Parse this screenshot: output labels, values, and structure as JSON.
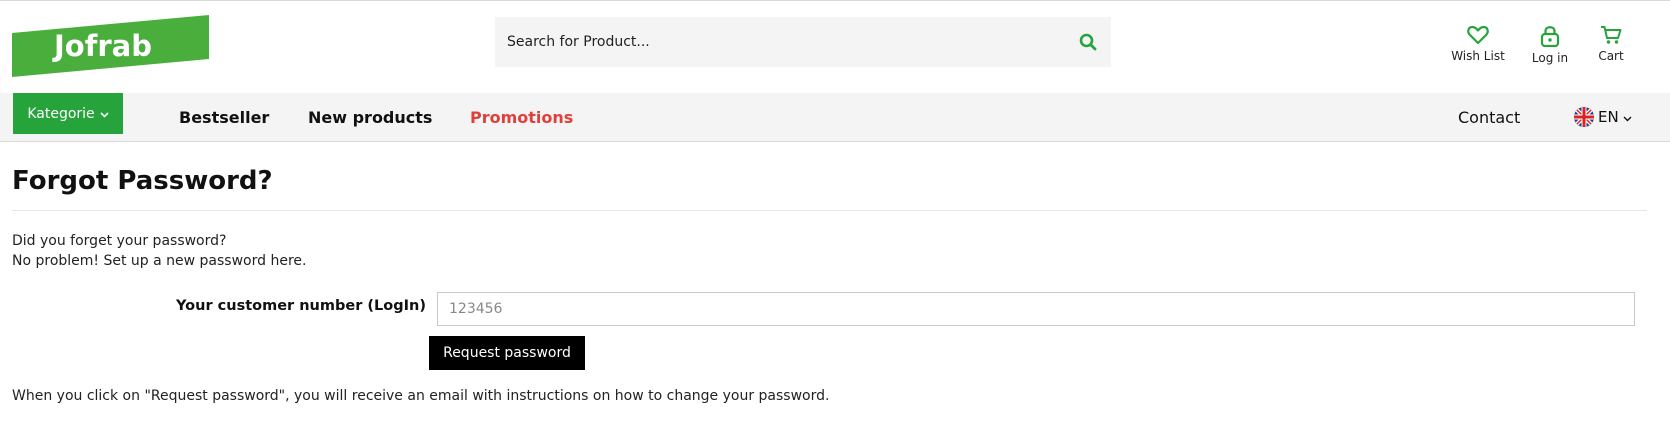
{
  "brand": {
    "logo_text": "Jofrab",
    "accent": "#26a33a",
    "promo_color": "#e0403c"
  },
  "search": {
    "placeholder": "Search for Product...",
    "icon": "search-icon"
  },
  "header_actions": [
    {
      "label": "Wish List",
      "icon": "heart-icon"
    },
    {
      "label": "Log in",
      "icon": "lock-icon"
    },
    {
      "label": "Cart",
      "icon": "cart-icon"
    }
  ],
  "nav": {
    "category_label": "Kategorie",
    "links": [
      "Bestseller",
      "New products",
      "Promotions"
    ],
    "contact": "Contact",
    "language": "EN"
  },
  "page": {
    "title": "Forgot Password?",
    "intro_line1": "Did you forget your password?",
    "intro_line2": "No problem! Set up a new password here.",
    "field_label": "Your customer number (LogIn)",
    "field_placeholder": "123456",
    "field_value": "",
    "button_label": "Request password",
    "note": "When you click on \"Request password\", you will receive an email with instructions on how to change your password."
  }
}
